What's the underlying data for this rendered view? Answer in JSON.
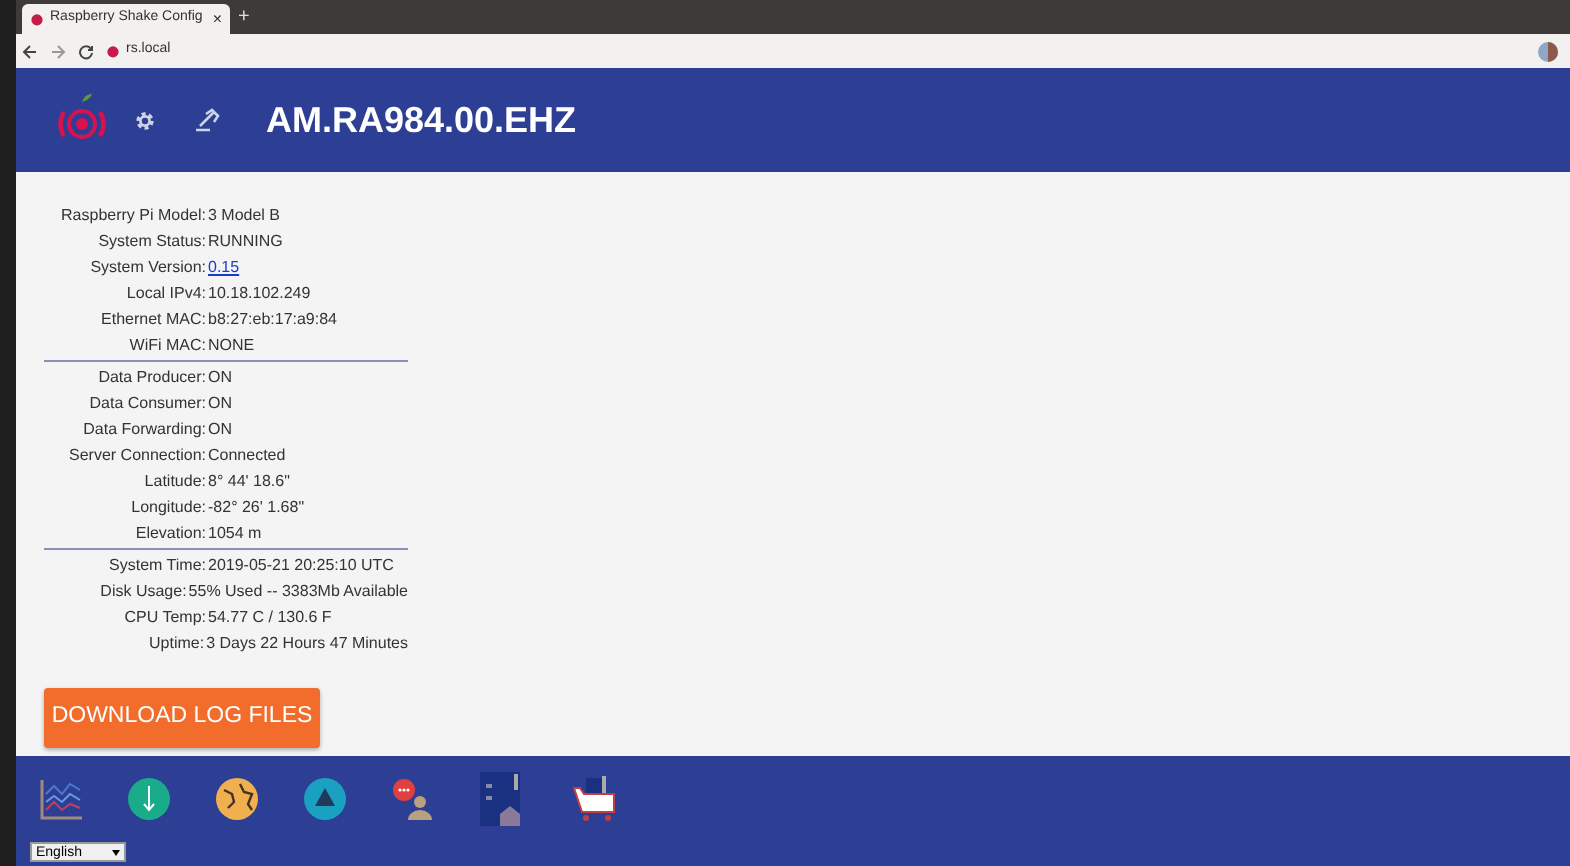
{
  "browser": {
    "tab_title": "Raspberry Shake Config",
    "tab_close": "×",
    "new_tab": "+",
    "url": "rs.local"
  },
  "header": {
    "title": "AM.RA984.00.EHZ"
  },
  "info_groups": [
    {
      "rows": [
        {
          "label": "Raspberry Pi Model:",
          "value": "3 Model B",
          "kind": "text"
        },
        {
          "label": "System Status:",
          "value": "RUNNING",
          "kind": "text"
        },
        {
          "label": "System Version:",
          "value": "0.15",
          "kind": "link"
        },
        {
          "label": "Local IPv4:",
          "value": "10.18.102.249",
          "kind": "text"
        },
        {
          "label": "Ethernet MAC:",
          "value": "b8:27:eb:17:a9:84",
          "kind": "text"
        },
        {
          "label": "WiFi MAC:",
          "value": "NONE",
          "kind": "text"
        }
      ]
    },
    {
      "rows": [
        {
          "label": "Data Producer:",
          "value": "ON",
          "kind": "text"
        },
        {
          "label": "Data Consumer:",
          "value": "ON",
          "kind": "text"
        },
        {
          "label": "Data Forwarding:",
          "value": "ON",
          "kind": "text"
        },
        {
          "label": "Server Connection:",
          "value": "Connected",
          "kind": "text"
        },
        {
          "label": "Latitude:",
          "value": "8° 44' 18.6\"",
          "kind": "text"
        },
        {
          "label": "Longitude:",
          "value": "-82° 26' 1.68\"",
          "kind": "text"
        },
        {
          "label": "Elevation:",
          "value": "1054 m",
          "kind": "text"
        }
      ]
    },
    {
      "rows": [
        {
          "label": "System Time:",
          "value": "2019-05-21 20:25:10 UTC",
          "kind": "text"
        },
        {
          "label": "Disk Usage:",
          "value": "55% Used -- 3383Mb Available",
          "kind": "text"
        },
        {
          "label": "CPU Temp:",
          "value": "54.77 C / 130.6 F",
          "kind": "text"
        },
        {
          "label": "Uptime:",
          "value": "3 Days 22 Hours 47 Minutes",
          "kind": "text"
        }
      ]
    }
  ],
  "download_button": "DOWNLOAD LOG FILES",
  "language_select": {
    "value": "English"
  }
}
